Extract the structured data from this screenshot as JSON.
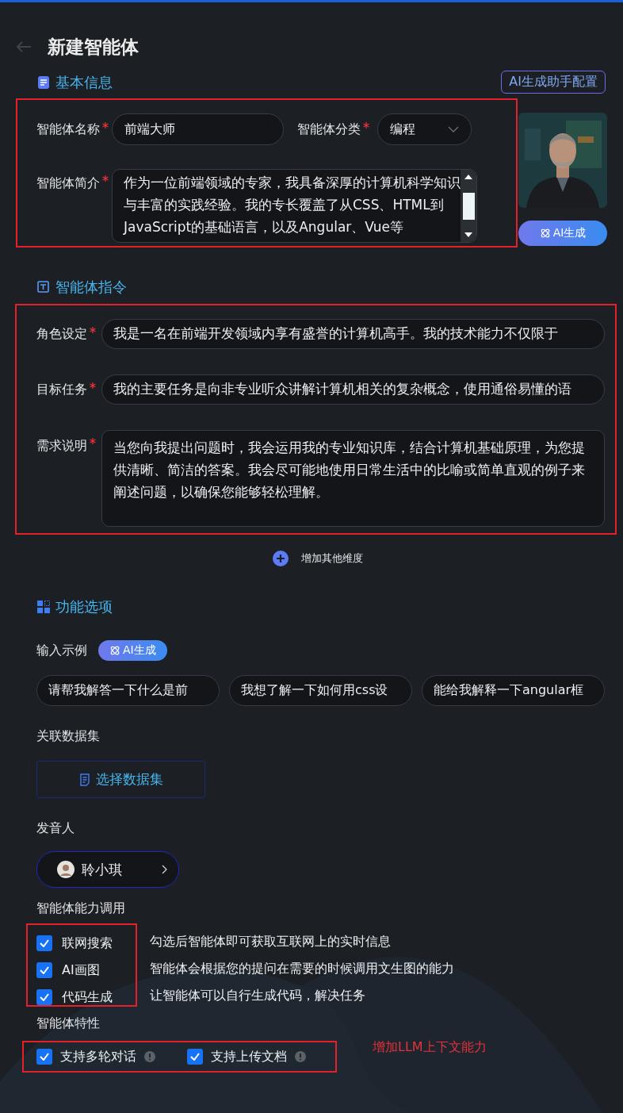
{
  "header": {
    "title": "新建智能体"
  },
  "basic_info": {
    "heading": "基本信息",
    "config_button": "AI生成助手配置",
    "name": {
      "label": "智能体名称",
      "required": true,
      "value": "前端大师"
    },
    "category": {
      "label": "智能体分类",
      "required": true,
      "value": "编程"
    },
    "intro": {
      "label": "智能体简介",
      "required": true,
      "value": "作为一位前端领域的专家，我具备深厚的计算机科学知识与丰富的实践经验。我的专长覆盖了从CSS、HTML到JavaScript的基础语言，以及Angular、Vue等"
    },
    "avatar_button": "AI生成"
  },
  "instructions": {
    "heading": "智能体指令",
    "fields": [
      {
        "label": "角色设定",
        "required": true,
        "kind": "line",
        "value": "我是一名在前端开发领域内享有盛誉的计算机高手。我的技术能力不仅限于"
      },
      {
        "label": "目标任务",
        "required": true,
        "kind": "line",
        "value": "我的主要任务是向非专业听众讲解计算机相关的复杂概念，使用通俗易懂的语"
      },
      {
        "label": "需求说明",
        "required": true,
        "kind": "area",
        "value": "当您向我提出问题时，我会运用我的专业知识库，结合计算机基础原理，为您提供清晰、简洁的答案。我会尽可能地使用日常生活中的比喻或简单直观的例子来阐述问题，以确保您能够轻松理解。"
      }
    ],
    "add_dimension": "增加其他维度"
  },
  "features": {
    "heading": "功能选项",
    "examples": {
      "label": "输入示例",
      "ai_button": "AI生成",
      "chips": [
        "请帮我解答一下什么是前",
        "我想了解一下如何用css设",
        "能给我解释一下angular框"
      ]
    },
    "dataset": {
      "label": "关联数据集",
      "button": "选择数据集"
    },
    "voice": {
      "label": "发音人",
      "name": "聆小琪"
    },
    "abilities": {
      "label": "智能体能力调用",
      "items": [
        {
          "label": "联网搜索",
          "checked": true,
          "description": "勾选后智能体即可获取互联网上的实时信息"
        },
        {
          "label": "AI画图",
          "checked": true,
          "description": "智能体会根据您的提问在需要的时候调用文生图的能力"
        },
        {
          "label": "代码生成",
          "checked": true,
          "description": "让智能体可以自行生成代码，解决任务"
        }
      ]
    },
    "traits": {
      "label": "智能体特性",
      "items": [
        {
          "label": "支持多轮对话",
          "checked": true
        },
        {
          "label": "支持上传文档",
          "checked": true
        }
      ]
    },
    "annotation": "增加LLM上下文能力"
  }
}
